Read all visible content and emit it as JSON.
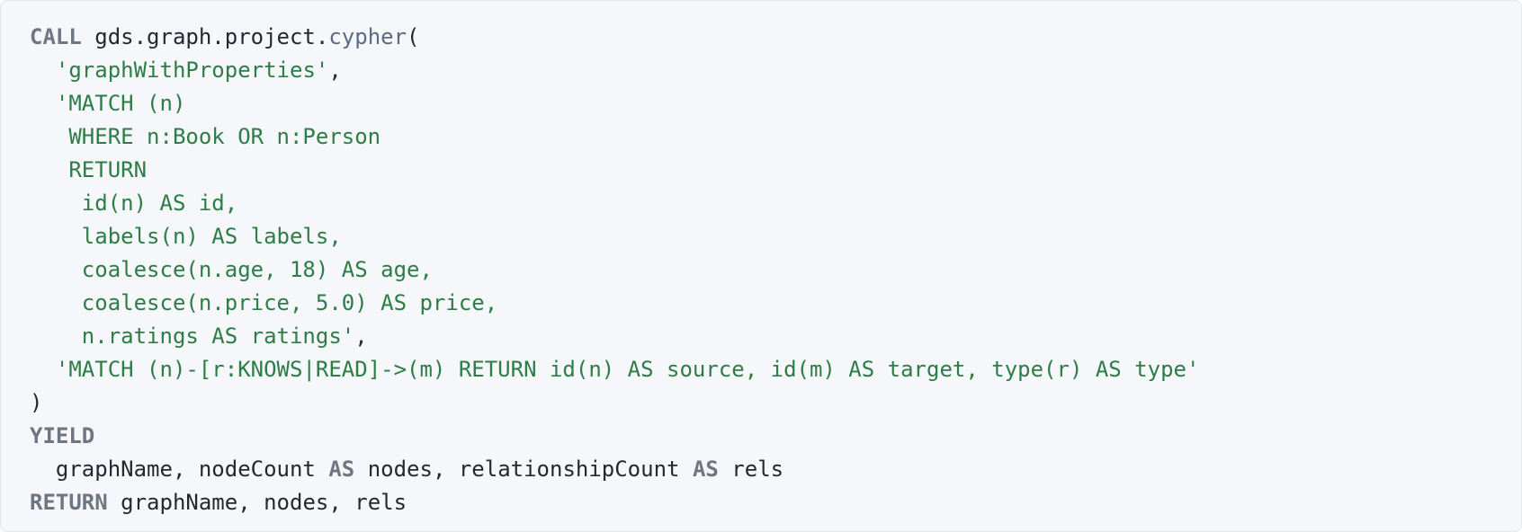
{
  "code_block": {
    "language": "cypher",
    "colors": {
      "background": "#f5f7fa",
      "keyword": "#6e7781",
      "plain": "#24292f",
      "function": "#5e6a80",
      "string": "#2d7d46"
    },
    "lines": [
      {
        "tokens": [
          {
            "type": "keyword",
            "text": "CALL"
          },
          {
            "type": "plain",
            "text": " gds.graph.project."
          },
          {
            "type": "func",
            "text": "cypher"
          },
          {
            "type": "plain",
            "text": "("
          }
        ]
      },
      {
        "tokens": [
          {
            "type": "plain",
            "text": "  "
          },
          {
            "type": "string",
            "text": "'graphWithProperties'"
          },
          {
            "type": "plain",
            "text": ","
          }
        ]
      },
      {
        "tokens": [
          {
            "type": "plain",
            "text": "  "
          },
          {
            "type": "string",
            "text": "'MATCH (n)"
          }
        ]
      },
      {
        "tokens": [
          {
            "type": "string",
            "text": "   WHERE n:Book OR n:Person"
          }
        ]
      },
      {
        "tokens": [
          {
            "type": "string",
            "text": "   RETURN"
          }
        ]
      },
      {
        "tokens": [
          {
            "type": "string",
            "text": "    id(n) AS id,"
          }
        ]
      },
      {
        "tokens": [
          {
            "type": "string",
            "text": "    labels(n) AS labels,"
          }
        ]
      },
      {
        "tokens": [
          {
            "type": "string",
            "text": "    coalesce(n.age, 18) AS age,"
          }
        ]
      },
      {
        "tokens": [
          {
            "type": "string",
            "text": "    coalesce(n.price, 5.0) AS price,"
          }
        ]
      },
      {
        "tokens": [
          {
            "type": "string",
            "text": "    n.ratings AS ratings'"
          },
          {
            "type": "plain",
            "text": ","
          }
        ]
      },
      {
        "tokens": [
          {
            "type": "plain",
            "text": "  "
          },
          {
            "type": "string",
            "text": "'MATCH (n)-[r:KNOWS|READ]->(m) RETURN id(n) AS source, id(m) AS target, type(r) AS type'"
          }
        ]
      },
      {
        "tokens": [
          {
            "type": "plain",
            "text": ")"
          }
        ]
      },
      {
        "tokens": [
          {
            "type": "keyword",
            "text": "YIELD"
          }
        ]
      },
      {
        "tokens": [
          {
            "type": "plain",
            "text": "  graphName, nodeCount "
          },
          {
            "type": "keyword",
            "text": "AS"
          },
          {
            "type": "plain",
            "text": " nodes, relationshipCount "
          },
          {
            "type": "keyword",
            "text": "AS"
          },
          {
            "type": "plain",
            "text": " rels"
          }
        ]
      },
      {
        "tokens": [
          {
            "type": "keyword",
            "text": "RETURN"
          },
          {
            "type": "plain",
            "text": " graphName, nodes, rels"
          }
        ]
      }
    ]
  }
}
